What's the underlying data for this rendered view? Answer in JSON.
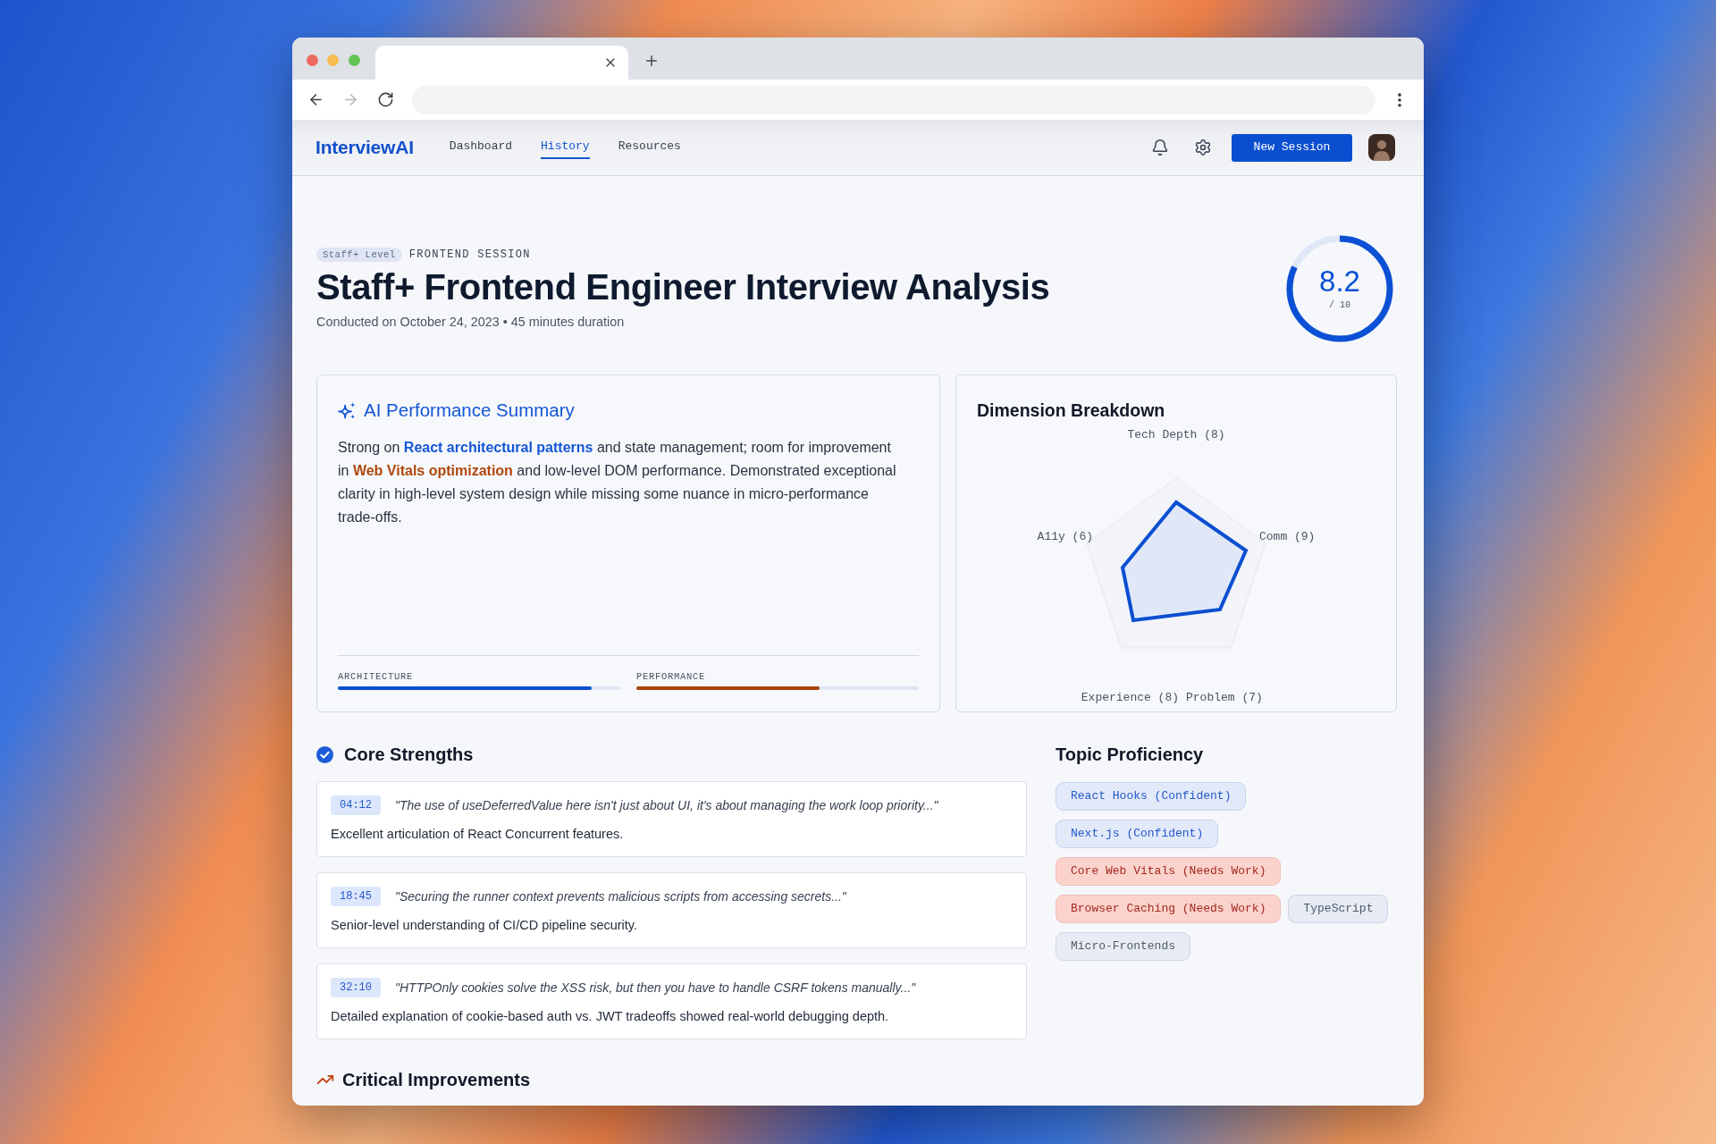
{
  "browser": {
    "nav_buttons": [
      {
        "kind": "back",
        "disabled": false
      },
      {
        "kind": "forward",
        "disabled": true
      },
      {
        "kind": "reload",
        "disabled": false
      }
    ]
  },
  "app_nav": {
    "logo": "InterviewAI",
    "links": [
      {
        "label": "Dashboard",
        "selected": false
      },
      {
        "label": "History",
        "selected": true
      },
      {
        "label": "Resources",
        "selected": false
      }
    ],
    "primary_button": "New Session"
  },
  "header": {
    "level_badge": "Staff+ Level",
    "session_type": "FRONTEND SESSION",
    "title": "Staff+ Frontend Engineer Interview Analysis",
    "subtitle": "Conducted on October 24, 2023 • 45 minutes duration",
    "score": {
      "value": "8.2",
      "scale": "/ 10",
      "level": 0.82
    }
  },
  "summary": {
    "title": "AI Performance Summary",
    "segments": [
      {
        "text": "Strong on ",
        "kind": "plain"
      },
      {
        "text": "React architectural patterns",
        "kind": "strength"
      },
      {
        "text": " and state management; room for improvement in ",
        "kind": "plain"
      },
      {
        "text": "Web Vitals optimization",
        "kind": "weakness"
      },
      {
        "text": " and low-level DOM performance. Demonstrated exceptional clarity in high-level system design while missing some nuance in micro-performance trade-offs.",
        "kind": "plain"
      }
    ],
    "metrics": [
      {
        "label": "ARCHITECTURE",
        "level": 0.9,
        "color": "#0b4fd1"
      },
      {
        "label": "PERFORMANCE",
        "level": 0.65,
        "color": "#a8420e"
      }
    ]
  },
  "dimensions": {
    "title": "Dimension Breakdown",
    "axes": [
      {
        "label": "Tech Depth (8)"
      },
      {
        "label": "Comm (9)"
      },
      {
        "label": "Problem (7)"
      },
      {
        "label": "Experience (8)"
      },
      {
        "label": "A11y (6)"
      }
    ]
  },
  "core_strengths": {
    "title": "Core Strengths",
    "items": [
      {
        "timestamp": "04:12",
        "quote": "\"The use of useDeferredValue here isn't just about UI, it's about managing the work loop priority...\"",
        "note": "Excellent articulation of React Concurrent features."
      },
      {
        "timestamp": "18:45",
        "quote": "\"Securing the runner context prevents malicious scripts from accessing secrets...\"",
        "note": "Senior-level understanding of CI/CD pipeline security."
      },
      {
        "timestamp": "32:10",
        "quote": "\"HTTPOnly cookies solve the XSS risk, but then you have to handle CSRF tokens manually...\"",
        "note": "Detailed explanation of cookie-based auth vs. JWT tradeoffs showed real-world debugging depth."
      }
    ]
  },
  "topic_proficiency": {
    "title": "Topic Proficiency",
    "topics": [
      {
        "label": "React Hooks (Confident)",
        "kind": "confident"
      },
      {
        "label": "Next.js (Confident)",
        "kind": "confident"
      },
      {
        "label": "Core Web Vitals (Needs Work)",
        "kind": "needs_work"
      },
      {
        "label": "Browser Caching (Needs Work)",
        "kind": "needs_work"
      },
      {
        "label": "TypeScript",
        "kind": "neutral"
      },
      {
        "label": "Micro-Frontends",
        "kind": "neutral"
      }
    ]
  },
  "critical_improvements": {
    "title": "Critical Improvements"
  }
}
